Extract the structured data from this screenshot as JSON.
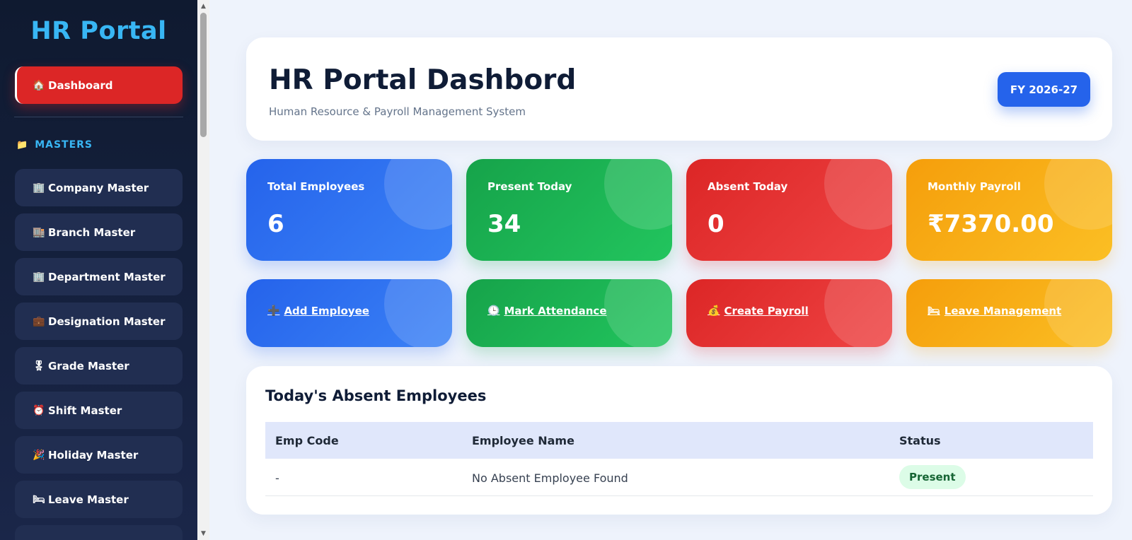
{
  "sidebar": {
    "brand": "HR Portal",
    "active_item": {
      "icon": "🏠",
      "label": "Dashboard"
    },
    "section_label": "MASTERS",
    "section_icon": "📁",
    "items": [
      {
        "icon": "🏢",
        "label": "Company Master"
      },
      {
        "icon": "🏬",
        "label": "Branch Master"
      },
      {
        "icon": "🏢",
        "label": "Department Master"
      },
      {
        "icon": "💼",
        "label": "Designation Master"
      },
      {
        "icon": "🎖",
        "label": "Grade Master"
      },
      {
        "icon": "⏰",
        "label": "Shift Master"
      },
      {
        "icon": "🎉",
        "label": "Holiday Master"
      },
      {
        "icon": "🛏",
        "label": "Leave Master"
      }
    ]
  },
  "header": {
    "title": "HR Portal Dashbord",
    "subtitle": "Human Resource & Payroll Management System",
    "fy_badge": "FY 2026-27"
  },
  "stats": [
    {
      "label": "Total Employees",
      "value": "6"
    },
    {
      "label": "Present Today",
      "value": "34"
    },
    {
      "label": "Absent Today",
      "value": "0"
    },
    {
      "label": "Monthly Payroll",
      "value": "₹7370.00"
    }
  ],
  "actions": [
    {
      "icon": "➕",
      "label": "Add Employee"
    },
    {
      "icon": "🕒",
      "label": "Mark Attendance"
    },
    {
      "icon": "💰",
      "label": "Create Payroll"
    },
    {
      "icon": "🛏",
      "label": "Leave Management"
    }
  ],
  "absent_table": {
    "title": "Today's Absent Employees",
    "columns": [
      "Emp Code",
      "Employee Name",
      "Status"
    ],
    "rows": [
      {
        "emp_code": "-",
        "employee_name": "No Absent Employee Found",
        "status": "Present"
      }
    ]
  },
  "colors": {
    "sidebar_bg": "#0f1a30",
    "brand": "#38b6f4",
    "active": "#dc2626",
    "blue": "#2563eb",
    "green": "#16a34a",
    "red": "#dc2626",
    "amber": "#f59e0b"
  }
}
